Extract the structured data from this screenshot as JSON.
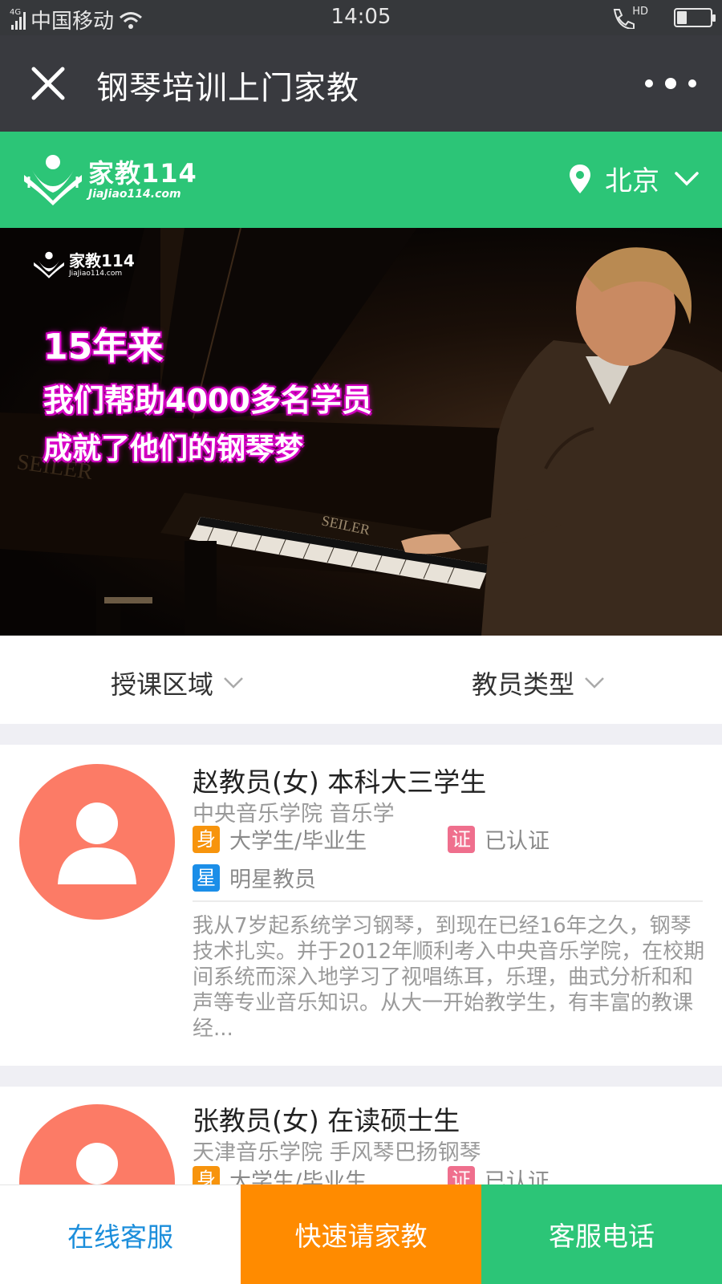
{
  "status_bar": {
    "network": "4G",
    "carrier": "中国移动",
    "time": "14:05",
    "hd_label": "HD",
    "battery_level": 0.3
  },
  "nav": {
    "close_icon": "close-icon",
    "title": "钢琴培训上门家教",
    "more_icon": "more-icon"
  },
  "brand": {
    "logo_name": "家教114",
    "logo_url": "JiaJiao114.com",
    "city": "北京",
    "colors": {
      "green": "#2cc577"
    }
  },
  "banner": {
    "logo_name": "家教114",
    "logo_url": "JiaJiao114.com",
    "line1": "15年来",
    "line2": "我们帮助4000多名学员",
    "line3": "成就了他们的钢琴梦",
    "brand_text": "SEILER"
  },
  "filters": {
    "area_label": "授课区域",
    "type_label": "教员类型"
  },
  "tutors": [
    {
      "name": "赵教员(女) 本科大三学生",
      "school": "中央音乐学院 音乐学",
      "identity_badge": "身",
      "identity": "大学生/毕业生",
      "cert_badge": "证",
      "cert": "已认证",
      "star_badge": "星",
      "star": "明星教员",
      "intro": "我从7岁起系统学习钢琴，到现在已经16年之久，钢琴技术扎实。并于2012年顺利考入中央音乐学院，在校期间系统而深入地学习了视唱练耳，乐理，曲式分析和和声等专业音乐知识。从大一开始教学生，有丰富的教课经..."
    },
    {
      "name": "张教员(女) 在读硕士生",
      "school": "天津音乐学院 手风琴巴扬钢琴",
      "identity_badge": "身",
      "identity": "大学生/毕业生",
      "cert_badge": "证",
      "cert": "已认证"
    }
  ],
  "bottom_bar": {
    "service": "在线客服",
    "quick": "快速请家教",
    "phone": "客服电话",
    "colors": {
      "orange": "#ff8b00",
      "green": "#2cc577",
      "blue": "#1c8edb"
    }
  }
}
